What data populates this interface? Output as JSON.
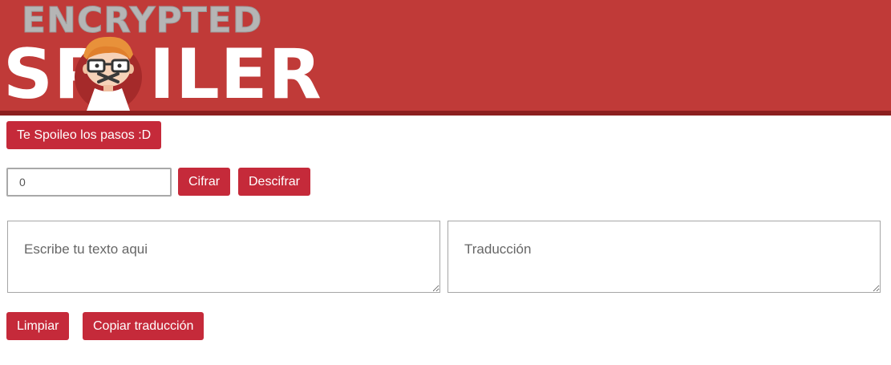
{
  "header": {
    "logo_top": "ENCRYPTED",
    "logo_bottom_left": "SP",
    "logo_bottom_right": "ILER",
    "mascot_icon": "mascot-icon"
  },
  "colors": {
    "header_bg": "#c03a38",
    "header_border": "#8c1f1f",
    "button_bg": "#c52a3a",
    "logo_gray": "#b5b5b5"
  },
  "steps_button": "Te Spoileo los pasos :D",
  "key": {
    "value": "0"
  },
  "actions": {
    "encrypt_label": "Cifrar",
    "decrypt_label": "Descifrar",
    "clear_label": "Limpiar",
    "copy_label": "Copiar traducción"
  },
  "input_text": {
    "placeholder": "Escribe tu texto aqui"
  },
  "output_text": {
    "placeholder": "Traducción"
  }
}
